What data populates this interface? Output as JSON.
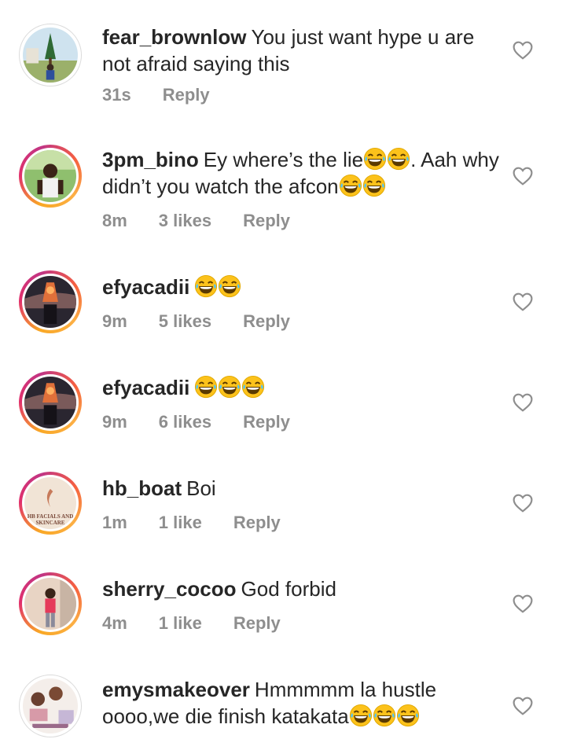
{
  "icons": {
    "like": "heart-outline-icon",
    "emoji": "face-with-tears-of-joy"
  },
  "colors": {
    "text": "#262626",
    "meta": "#8e8e8e",
    "ring_start": "#f9a825",
    "ring_end": "#c13584"
  },
  "comments": [
    {
      "username": "fear_brownlow",
      "text": "You just want hype u are not afraid saying this",
      "emoji_count": 0,
      "time": "31s",
      "likes": "",
      "reply": "Reply"
    },
    {
      "username": "3pm_bino",
      "text": "Ey where’s the lie",
      "emoji_count": 0,
      "time": "8m",
      "likes": "3 likes",
      "reply": "Reply"
    },
    {
      "username": "efyacadii",
      "text": "",
      "emoji_count": 2,
      "time": "9m",
      "likes": "5 likes",
      "reply": "Reply"
    },
    {
      "username": "efyacadii",
      "text": "",
      "emoji_count": 3,
      "time": "9m",
      "likes": "6 likes",
      "reply": "Reply"
    },
    {
      "username": "hb_boat",
      "text": "Boi",
      "emoji_count": 0,
      "time": "1m",
      "likes": "1 like",
      "reply": "Reply"
    },
    {
      "username": "sherry_cocoo",
      "text": "God forbid",
      "emoji_count": 0,
      "time": "4m",
      "likes": "1 like",
      "reply": "Reply"
    },
    {
      "username": "emysmakeover",
      "text": "Hmmmmm la hustle oooo,we die finish katakata",
      "emoji_count": 3,
      "time": "",
      "likes": "",
      "reply": ""
    }
  ],
  "extra_text": {
    "bino_part2": ". Aah why didn’t you watch the afcon",
    "hb_avatar_text": "HB FACIALS AND SKINCARE"
  }
}
